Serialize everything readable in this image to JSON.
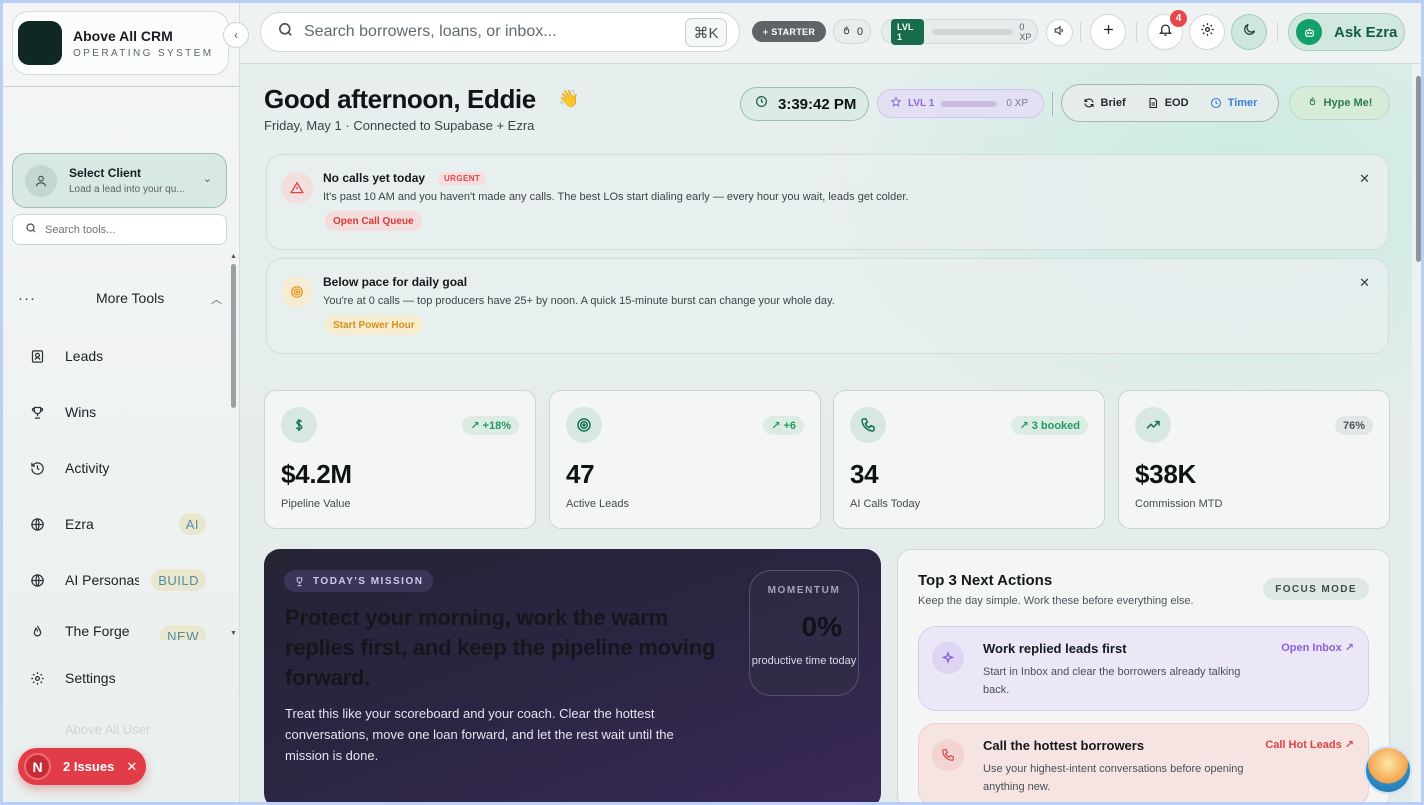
{
  "brand": {
    "title": "Above All CRM",
    "subtitle": "OPERATING SYSTEM"
  },
  "sidebar": {
    "client": {
      "title": "Select Client",
      "subtitle": "Load a lead into your qu..."
    },
    "tool_search_placeholder": "Search tools...",
    "more_tools_label": "More Tools",
    "items": [
      {
        "label": "Leads"
      },
      {
        "label": "Wins"
      },
      {
        "label": "Activity"
      },
      {
        "label": "Ezra",
        "badge": "AI"
      },
      {
        "label": "AI Personas",
        "badge": "BUILD"
      },
      {
        "label": "The Forge",
        "badge": "NEW"
      },
      {
        "label": "Settings"
      }
    ],
    "user_ghost": "Above All User",
    "issues": {
      "count_label": "N",
      "label": "2 Issues"
    }
  },
  "topbar": {
    "search_placeholder": "Search borrowers, loans, or inbox...",
    "shortcut": "⌘K",
    "plan": "+ STARTER",
    "streak": "0",
    "level": "LVL 1",
    "xp": "0 XP",
    "notifications": "4",
    "ask_label": "Ask Ezra"
  },
  "greeting": {
    "title": "Good afternoon, Eddie",
    "subtitle": "Friday, May 1 · Connected to Supabase + Ezra",
    "clock": "3:39:42 PM",
    "level": "LVL 1",
    "level_progress": 0,
    "xp": "0 XP",
    "buttons": {
      "brief": "Brief",
      "eod": "EOD",
      "timer": "Timer",
      "hype": "Hype Me!"
    }
  },
  "alerts": [
    {
      "title": "No calls yet today",
      "tag": "URGENT",
      "message": "It's past 10 AM and you haven't made any calls. The best LOs start dialing early — every hour you wait, leads get colder.",
      "cta": "Open Call Queue"
    },
    {
      "title": "Below pace for daily goal",
      "message": "You're at 0 calls — top producers have 25+ by noon. A quick 15-minute burst can change your whole day.",
      "cta": "Start Power Hour"
    }
  ],
  "stats": [
    {
      "value": "$4.2M",
      "label": "Pipeline Value",
      "delta": "+18%"
    },
    {
      "value": "47",
      "label": "Active Leads",
      "delta": "+6"
    },
    {
      "value": "34",
      "label": "AI Calls Today",
      "delta": "3 booked"
    },
    {
      "value": "$38K",
      "label": "Commission MTD",
      "delta": "76%"
    }
  ],
  "mission": {
    "tag": "TODAY'S MISSION",
    "headline": "Protect your morning, work the warm replies first, and keep the pipeline moving forward.",
    "body": "Treat this like your scoreboard and your coach. Clear the hottest conversations, move one loan forward, and let the rest wait until the mission is done.",
    "momentum_label": "MOMENTUM",
    "momentum_value": "0%",
    "momentum_sub": "productive time today"
  },
  "next_actions": {
    "title": "Top 3 Next Actions",
    "subtitle": "Keep the day simple. Work these before everything else.",
    "focus_label": "FOCUS MODE",
    "items": [
      {
        "title": "Work replied leads first",
        "desc": "Start in Inbox and clear the borrowers already talking back.",
        "link": "Open Inbox"
      },
      {
        "title": "Call the hottest borrowers",
        "desc": "Use your highest-intent conversations before opening anything new.",
        "link": "Call Hot Leads"
      }
    ]
  }
}
